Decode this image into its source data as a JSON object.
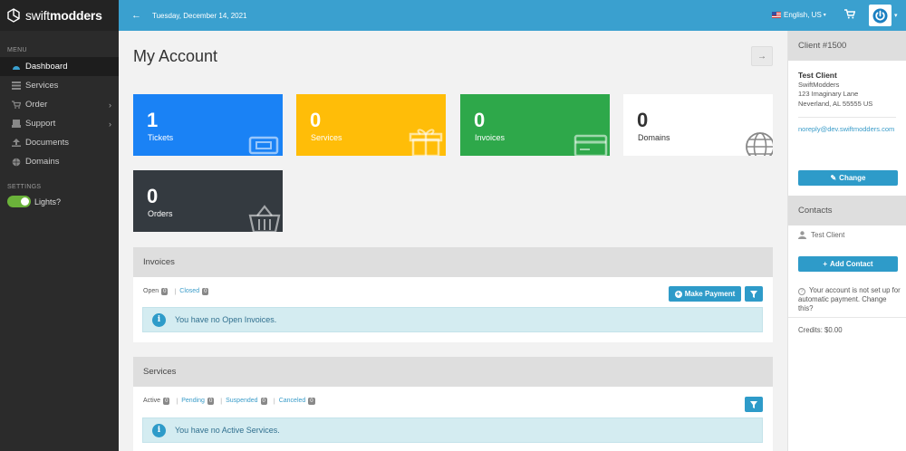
{
  "sidebar": {
    "logo": {
      "prefix": "swift",
      "suffix": "modders"
    },
    "menu_heading": "MENU",
    "items": [
      {
        "label": "Dashboard",
        "icon": "dashboard-icon"
      },
      {
        "label": "Services",
        "icon": "services-icon"
      },
      {
        "label": "Order",
        "icon": "cart-icon"
      },
      {
        "label": "Support",
        "icon": "support-icon"
      },
      {
        "label": "Documents",
        "icon": "documents-icon"
      },
      {
        "label": "Domains",
        "icon": "globe-icon"
      }
    ],
    "settings_heading": "SETTINGS",
    "lights_label": "Lights?"
  },
  "topbar": {
    "date": "Tuesday, December 14, 2021",
    "language": "English, US",
    "accent": "#3aa0cf"
  },
  "page": {
    "title": "My Account"
  },
  "tiles": [
    {
      "value": "1",
      "label": "Tickets",
      "color": "#1a82f5"
    },
    {
      "value": "0",
      "label": "Services",
      "color": "#ffbd08"
    },
    {
      "value": "0",
      "label": "Invoices",
      "color": "#2ea84a"
    },
    {
      "value": "0",
      "label": "Domains",
      "color": "#ffffff"
    },
    {
      "value": "0",
      "label": "Orders",
      "color": "#343a40"
    }
  ],
  "invoices": {
    "heading": "Invoices",
    "filters": [
      {
        "label": "Open",
        "count": "0"
      },
      {
        "label": "Closed",
        "count": "0"
      }
    ],
    "make_payment": "Make Payment",
    "alert": "You have no Open Invoices."
  },
  "services": {
    "heading": "Services",
    "filters": [
      {
        "label": "Active",
        "count": "0"
      },
      {
        "label": "Pending",
        "count": "0"
      },
      {
        "label": "Suspended",
        "count": "0"
      },
      {
        "label": "Canceled",
        "count": "0"
      }
    ],
    "alert": "You have no Active Services."
  },
  "client": {
    "heading": "Client #1500",
    "name": "Test Client",
    "company": "SwiftModders",
    "address1": "123 Imaginary Lane",
    "address2": "Neverland, AL 55555 US",
    "email": "noreply@dev.swiftmodders.com",
    "change_label": "Change"
  },
  "contacts": {
    "heading": "Contacts",
    "contact_name": "Test Client",
    "add_label": "Add Contact",
    "autopay_note": "Your account is not set up for automatic payment. Change this?",
    "credits": "Credits: $0.00"
  }
}
